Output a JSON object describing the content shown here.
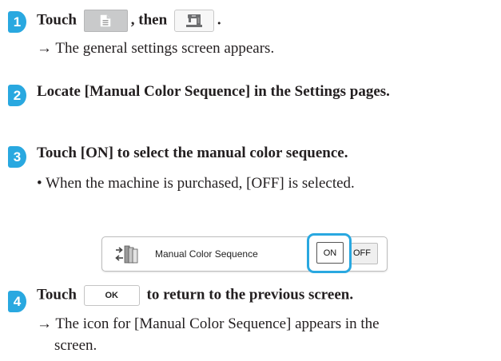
{
  "steps": [
    {
      "number": "1",
      "lead": "Touch",
      "mid": ", then",
      "end": ".",
      "result": "→ The general settings screen appears."
    },
    {
      "number": "2",
      "text": "Locate [Manual Color Sequence] in the Settings pages."
    },
    {
      "number": "3",
      "text": "Touch [ON] to select the manual color sequence.",
      "note": "• When the machine is purchased, [OFF] is selected."
    },
    {
      "number": "4",
      "lead": "Touch",
      "ok_label": "OK",
      "tail": "to return to the previous screen.",
      "result_line1": "→ The icon for [Manual Color Sequence] appears in the",
      "result_line2": "screen."
    }
  ],
  "setting_panel": {
    "label": "Manual Color Sequence",
    "on_label": "ON",
    "off_label": "OFF",
    "selected": "ON"
  },
  "icons": {
    "home": "page-icon",
    "settings": "sewing-machine-icon",
    "panel": "color-sequence-icon"
  },
  "colors": {
    "accent": "#29a8e0",
    "text": "#231f20"
  }
}
